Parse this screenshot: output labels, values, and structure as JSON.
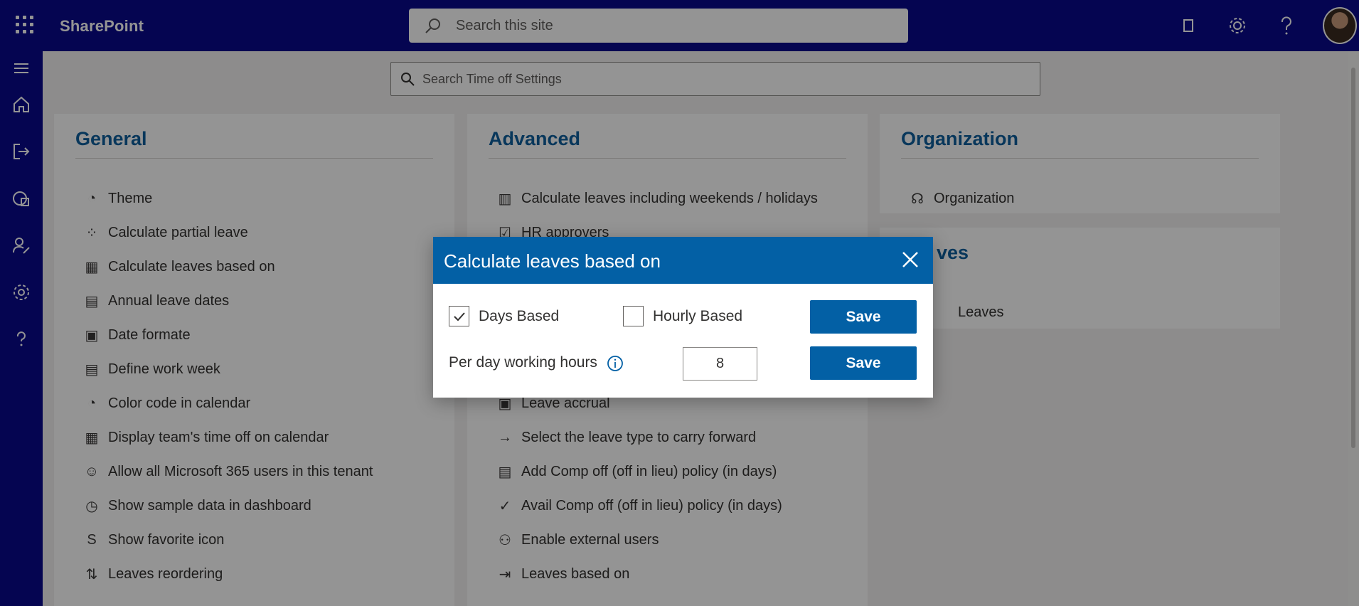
{
  "app": {
    "brand": "SharePoint",
    "search_placeholder": "Search this site"
  },
  "settings_search": {
    "placeholder": "Search Time off Settings"
  },
  "panels": {
    "general": {
      "title": "General",
      "items": [
        {
          "label": "Theme",
          "icon": "palette-icon"
        },
        {
          "label": "Calculate partial leave",
          "icon": "partial-leave-icon"
        },
        {
          "label": "Calculate leaves based on",
          "icon": "calculator-icon"
        },
        {
          "label": "Annual leave dates",
          "icon": "calendar-icon"
        },
        {
          "label": "Date formate",
          "icon": "calendar-clock-icon"
        },
        {
          "label": "Define work week",
          "icon": "calendar-week-icon"
        },
        {
          "label": "Color code in calendar",
          "icon": "palette-icon"
        },
        {
          "label": "Display team's time off on calendar",
          "icon": "calendar-team-icon"
        },
        {
          "label": "Allow all Microsoft 365 users in this tenant",
          "icon": "user-check-icon"
        },
        {
          "label": "Show sample data in dashboard",
          "icon": "dashboard-icon"
        },
        {
          "label": "Show favorite icon",
          "icon": "sharepoint-icon"
        },
        {
          "label": "Leaves reordering",
          "icon": "sort-icon"
        }
      ]
    },
    "advanced": {
      "title": "Advanced",
      "items": [
        {
          "label": "Calculate leaves including weekends / holidays",
          "icon": "calendar-grid-icon"
        },
        {
          "label": "HR approvers",
          "icon": "approvers-icon"
        },
        {
          "label": "Leave accrual",
          "icon": "accrual-icon"
        },
        {
          "label": "Select the leave type to carry forward",
          "icon": "arrow-right-icon"
        },
        {
          "label": "Add Comp off (off in lieu) policy (in days)",
          "icon": "document-icon"
        },
        {
          "label": "Avail Comp off (off in lieu) policy (in days)",
          "icon": "checkmark-icon"
        },
        {
          "label": "Enable external users",
          "icon": "people-icon"
        },
        {
          "label": "Leaves based on",
          "icon": "sign-out-icon"
        }
      ]
    },
    "organization": {
      "title": "Organization",
      "items": [
        {
          "label": "Organization",
          "icon": "org-chart-icon"
        }
      ]
    },
    "leaves": {
      "title_partial": "ves",
      "item_partial": "Leaves"
    }
  },
  "dialog": {
    "title": "Calculate leaves based on",
    "days_label": "Days Based",
    "days_checked": true,
    "hourly_label": "Hourly Based",
    "hourly_checked": false,
    "hours_label": "Per day working hours",
    "hours_value": "8",
    "save_label": "Save"
  },
  "colors": {
    "topbar": "#0a0a8c",
    "accent": "#0360a5",
    "heading": "#0f5f9e"
  }
}
